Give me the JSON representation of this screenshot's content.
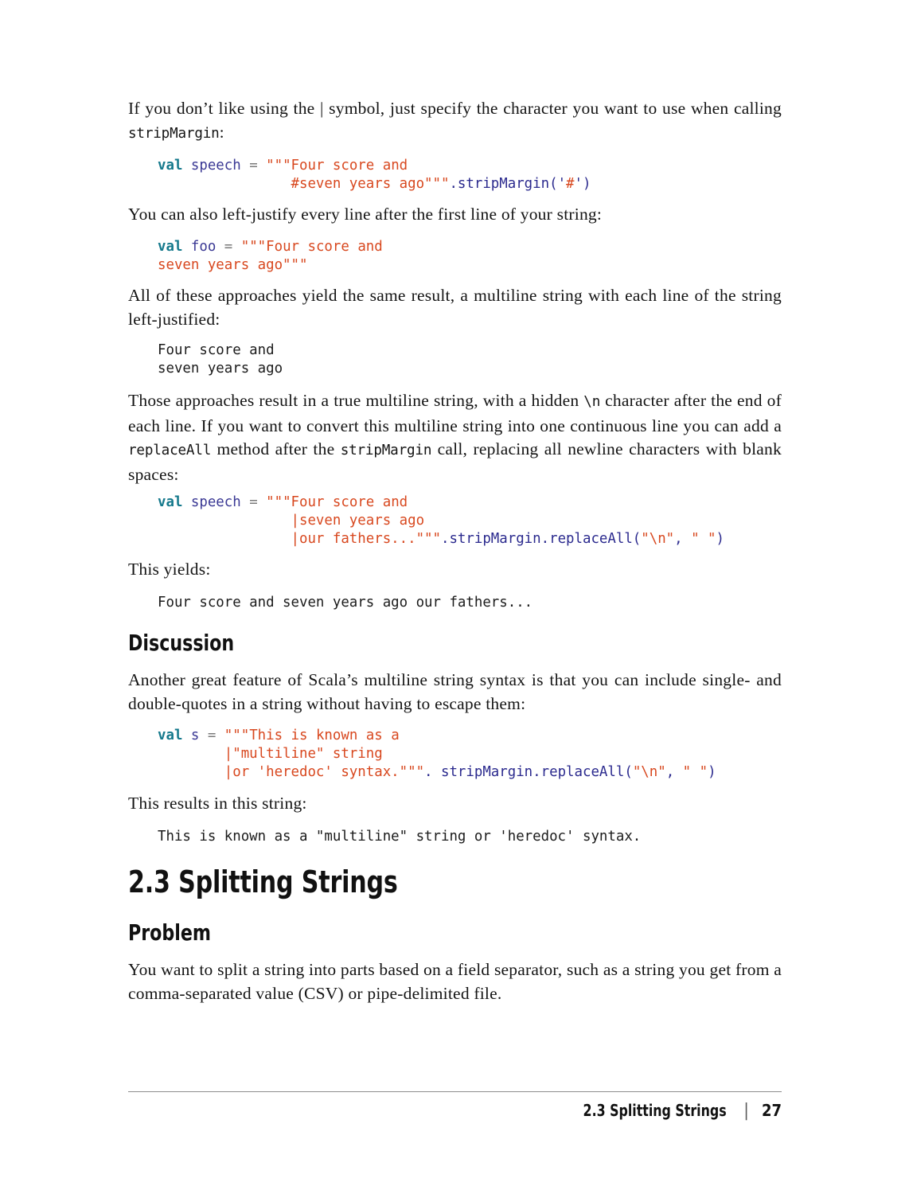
{
  "page": {
    "number": "27",
    "footer_title": "2.3 Splitting Strings",
    "footer_separator": "|"
  },
  "blocks": {
    "p1_a": "If you don’t like using the | symbol, just specify the character you want to use when calling ",
    "p1_code": "stripMargin",
    "p1_b": ":",
    "code1": {
      "l1_kw": "val",
      "l1_id": " speech",
      "l1_op": " = ",
      "l1_str": "\"\"\"Four score and",
      "l2_str": "                #seven years ago\"\"\"",
      "l2_m": ".stripMargin('",
      "l2_chr": "#",
      "l2_m2": "')"
    },
    "p2": "You can also left-justify every line after the first line of your string:",
    "code2": {
      "l1_kw": "val",
      "l1_id": " foo",
      "l1_op": " = ",
      "l1_str": "\"\"\"Four score and",
      "l2_str": "seven years ago\"\"\""
    },
    "p3": "All of these approaches yield the same result, a multiline string with each line of the string left-justified:",
    "out1": "Four score and\nseven years ago",
    "p4_a": "Those approaches result in a true multiline string, with a hidden ",
    "p4_c1": "\\n",
    "p4_b": " character after the end of each line. If you want to convert this multiline string into one continuous line you can add a ",
    "p4_c2": "replaceAll",
    "p4_c": " method after the ",
    "p4_c3": "stripMargin",
    "p4_d": " call, replacing all newline characters with blank spaces:",
    "code3": {
      "l1_kw": "val",
      "l1_id": " speech",
      "l1_op": " = ",
      "l1_str": "\"\"\"Four score and",
      "l2_str": "                |seven years ago",
      "l3_str": "                |our fathers...\"\"\"",
      "l3_m": ".stripMargin.replaceAll(",
      "l3_s1": "\"\\n\"",
      "l3_m2": ", ",
      "l3_s2": "\" \"",
      "l3_m3": ")"
    },
    "p5": "This yields:",
    "out2": "Four score and seven years ago our fathers...",
    "h_discussion": "Discussion",
    "p6": "Another great feature of Scala’s multiline string syntax is that you can include single- and double-quotes in a string without having to escape them:",
    "code4": {
      "l1_kw": "val",
      "l1_id": " s",
      "l1_op": " = ",
      "l1_str": "\"\"\"This is known as a",
      "l2_str": "        |\"multiline\" string",
      "l3_str": "        |or 'heredoc' syntax.\"\"\"",
      "l3_m": ". stripMargin.replaceAll(",
      "l3_s1": "\"\\n\"",
      "l3_m2": ", ",
      "l3_s2": "\" \"",
      "l3_m3": ")"
    },
    "p7": "This results in this string:",
    "out3": "This is known as a \"multiline\" string or 'heredoc' syntax.",
    "h_section": "2.3 Splitting Strings",
    "h_problem": "Problem",
    "p8": "You want to split a string into parts based on a field separator, such as a string you get from a comma-separated value (CSV) or pipe-delimited file."
  },
  "colors": {
    "keyword": "#15798c",
    "identifier": "#3a3894",
    "string": "#d8481f",
    "method": "#2b2a8e",
    "operator": "#7a7a7a",
    "text": "#141414",
    "rule": "#8e8e8e"
  }
}
